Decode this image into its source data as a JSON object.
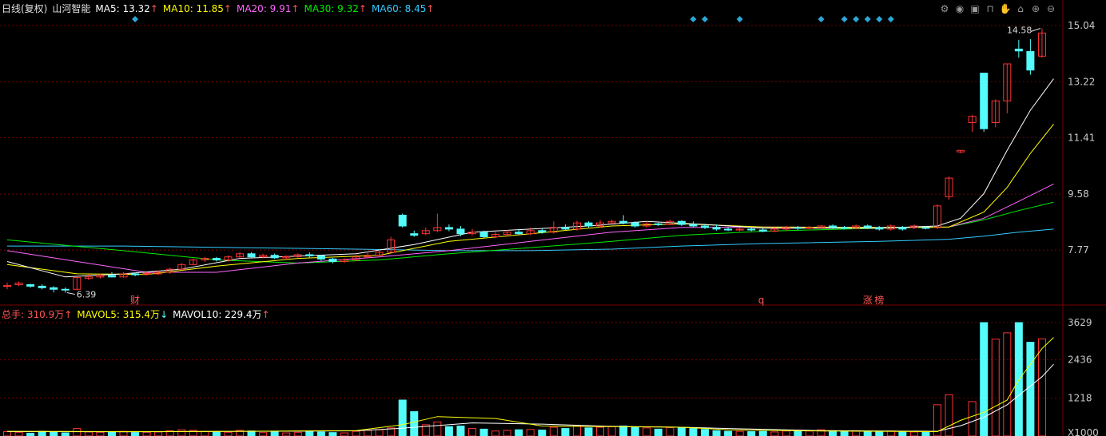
{
  "header": {
    "period": "日线(复权)",
    "name": "山河智能",
    "ma": [
      {
        "label": "MA5: 13.32",
        "arrow": "↑",
        "color": "#ffffff"
      },
      {
        "label": "MA10: 11.85",
        "arrow": "↑",
        "color": "#ffff00"
      },
      {
        "label": "MA20: 9.91",
        "arrow": "↑",
        "color": "#ff66ff"
      },
      {
        "label": "MA30: 9.32",
        "arrow": "↑",
        "color": "#00ee00"
      },
      {
        "label": "MA60: 8.45",
        "arrow": "↑",
        "color": "#33ccff"
      }
    ]
  },
  "vol_header": {
    "total": "总手: 310.9万",
    "total_arrow": "↑",
    "mavol5": "MAVOL5: 315.4万",
    "mavol5_arrow": "↓",
    "mavol10": "MAVOL10: 229.4万",
    "mavol10_arrow": "↑"
  },
  "toolbar": [
    "gear-icon",
    "eye-icon",
    "box-icon",
    "bag-icon",
    "hand-icon",
    "lock-icon",
    "plus-icon",
    "minus-icon"
  ],
  "colors": {
    "up": "#ff3333",
    "down": "#54fcfc",
    "grid": "#7a0000",
    "axis_text": "#c8c8c8",
    "ma5": "#ffffff",
    "ma10": "#ffff00",
    "ma20": "#ff66ff",
    "ma30": "#00ee00",
    "ma60": "#33ccff",
    "marker": "#2aa8d8"
  },
  "chart_data": {
    "type": "candlestick",
    "price_ticks": [
      "15.04",
      "13.22",
      "11.41",
      "9.58",
      "7.77"
    ],
    "volume_ticks": [
      "3629",
      "2436",
      "1218",
      "X1000"
    ],
    "price_range": [
      6.3,
      15.3
    ],
    "volume_range": [
      0,
      3629
    ],
    "annotations": {
      "high_label": "14.58",
      "low_label": "6.39",
      "events": [
        {
          "index": 11,
          "text": "财"
        },
        {
          "index": 65,
          "text": "q"
        },
        {
          "index": 74,
          "text": "涨"
        },
        {
          "index": 75,
          "text": "榜"
        }
      ],
      "diamonds": [
        11,
        59,
        60,
        63,
        70,
        72,
        73,
        74,
        75,
        76
      ]
    },
    "candles": [
      [
        6.6,
        6.62,
        6.5,
        6.72,
        140
      ],
      [
        6.65,
        6.7,
        6.6,
        6.75,
        120
      ],
      [
        6.65,
        6.6,
        6.55,
        6.68,
        90
      ],
      [
        6.6,
        6.55,
        6.5,
        6.66,
        150
      ],
      [
        6.55,
        6.5,
        6.4,
        6.6,
        130
      ],
      [
        6.5,
        6.48,
        6.39,
        6.56,
        100
      ],
      [
        6.5,
        6.88,
        6.46,
        6.92,
        240
      ],
      [
        6.85,
        6.9,
        6.8,
        6.98,
        130
      ],
      [
        6.9,
        6.95,
        6.85,
        7.0,
        120
      ],
      [
        6.95,
        6.9,
        6.88,
        7.05,
        140
      ],
      [
        6.9,
        7.0,
        6.88,
        7.05,
        150
      ],
      [
        7.0,
        6.97,
        6.92,
        7.04,
        110
      ],
      [
        7.0,
        7.02,
        6.95,
        7.06,
        120
      ],
      [
        7.0,
        7.05,
        6.96,
        7.1,
        130
      ],
      [
        7.05,
        7.15,
        7.0,
        7.2,
        170
      ],
      [
        7.15,
        7.3,
        7.12,
        7.35,
        200
      ],
      [
        7.3,
        7.45,
        7.28,
        7.5,
        180
      ],
      [
        7.45,
        7.5,
        7.38,
        7.55,
        150
      ],
      [
        7.5,
        7.45,
        7.4,
        7.55,
        140
      ],
      [
        7.45,
        7.55,
        7.4,
        7.6,
        120
      ],
      [
        7.55,
        7.65,
        7.5,
        7.7,
        180
      ],
      [
        7.65,
        7.55,
        7.5,
        7.7,
        160
      ],
      [
        7.55,
        7.6,
        7.5,
        7.65,
        110
      ],
      [
        7.6,
        7.52,
        7.48,
        7.66,
        130
      ],
      [
        7.52,
        7.56,
        7.46,
        7.6,
        100
      ],
      [
        7.56,
        7.62,
        7.5,
        7.66,
        120
      ],
      [
        7.62,
        7.58,
        7.52,
        7.7,
        140
      ],
      [
        7.58,
        7.48,
        7.42,
        7.62,
        130
      ],
      [
        7.48,
        7.4,
        7.34,
        7.52,
        110
      ],
      [
        7.4,
        7.45,
        7.35,
        7.5,
        100
      ],
      [
        7.45,
        7.55,
        7.42,
        7.62,
        150
      ],
      [
        7.55,
        7.6,
        7.5,
        7.72,
        180
      ],
      [
        7.6,
        7.7,
        7.55,
        7.78,
        200
      ],
      [
        7.7,
        8.1,
        7.68,
        8.2,
        260
      ],
      [
        8.9,
        8.55,
        8.5,
        8.95,
        1150
      ],
      [
        8.3,
        8.25,
        8.2,
        8.4,
        780
      ],
      [
        8.3,
        8.4,
        8.25,
        8.5,
        360
      ],
      [
        8.4,
        8.5,
        8.35,
        8.95,
        450
      ],
      [
        8.5,
        8.45,
        8.38,
        8.6,
        300
      ],
      [
        8.45,
        8.3,
        8.22,
        8.55,
        320
      ],
      [
        8.3,
        8.35,
        8.25,
        8.45,
        240
      ],
      [
        8.35,
        8.2,
        8.15,
        8.4,
        220
      ],
      [
        8.2,
        8.28,
        8.15,
        8.36,
        160
      ],
      [
        8.28,
        8.35,
        8.2,
        8.42,
        180
      ],
      [
        8.35,
        8.3,
        8.25,
        8.45,
        200
      ],
      [
        8.3,
        8.4,
        8.25,
        8.5,
        210
      ],
      [
        8.4,
        8.35,
        8.3,
        8.48,
        190
      ],
      [
        8.35,
        8.5,
        8.3,
        8.7,
        280
      ],
      [
        8.5,
        8.45,
        8.4,
        8.6,
        240
      ],
      [
        8.45,
        8.65,
        8.4,
        8.72,
        320
      ],
      [
        8.65,
        8.55,
        8.5,
        8.7,
        260
      ],
      [
        8.55,
        8.65,
        8.5,
        8.74,
        280
      ],
      [
        8.65,
        8.7,
        8.6,
        8.75,
        300
      ],
      [
        8.7,
        8.65,
        8.6,
        8.9,
        320
      ],
      [
        8.65,
        8.55,
        8.5,
        8.7,
        280
      ],
      [
        8.55,
        8.62,
        8.5,
        8.7,
        260
      ],
      [
        8.62,
        8.6,
        8.55,
        8.66,
        220
      ],
      [
        8.6,
        8.7,
        8.58,
        8.75,
        270
      ],
      [
        8.7,
        8.6,
        8.55,
        8.74,
        260
      ],
      [
        8.6,
        8.55,
        8.5,
        8.7,
        240
      ],
      [
        8.55,
        8.5,
        8.45,
        8.62,
        210
      ],
      [
        8.5,
        8.45,
        8.4,
        8.6,
        170
      ],
      [
        8.45,
        8.42,
        8.38,
        8.5,
        150
      ],
      [
        8.42,
        8.45,
        8.38,
        8.5,
        150
      ],
      [
        8.45,
        8.42,
        8.38,
        8.52,
        140
      ],
      [
        8.42,
        8.38,
        8.35,
        8.5,
        150
      ],
      [
        8.38,
        8.45,
        8.35,
        8.5,
        130
      ],
      [
        8.45,
        8.5,
        8.4,
        8.55,
        160
      ],
      [
        8.5,
        8.48,
        8.42,
        8.55,
        150
      ],
      [
        8.48,
        8.5,
        8.45,
        8.55,
        160
      ],
      [
        8.5,
        8.55,
        8.45,
        8.58,
        200
      ],
      [
        8.55,
        8.5,
        8.45,
        8.6,
        170
      ],
      [
        8.5,
        8.48,
        8.44,
        8.55,
        160
      ],
      [
        8.48,
        8.55,
        8.45,
        8.6,
        170
      ],
      [
        8.55,
        8.5,
        8.45,
        8.6,
        140
      ],
      [
        8.5,
        8.45,
        8.4,
        8.55,
        150
      ],
      [
        8.45,
        8.55,
        8.4,
        8.6,
        160
      ],
      [
        8.5,
        8.45,
        8.4,
        8.55,
        150
      ],
      [
        8.5,
        8.55,
        8.45,
        8.6,
        130
      ],
      [
        8.5,
        8.48,
        8.44,
        8.55,
        120
      ],
      [
        8.5,
        9.2,
        8.45,
        9.25,
        1000
      ],
      [
        9.5,
        10.1,
        9.4,
        10.15,
        1320
      ],
      [
        10.95,
        11.0,
        10.9,
        11.0,
        0
      ],
      [
        11.9,
        12.1,
        11.6,
        12.15,
        1100
      ],
      [
        13.5,
        11.7,
        11.6,
        13.5,
        3629
      ],
      [
        11.9,
        12.6,
        11.75,
        12.65,
        3100
      ],
      [
        12.6,
        13.8,
        12.2,
        13.8,
        3300
      ],
      [
        14.28,
        14.22,
        14.0,
        14.58,
        3629
      ],
      [
        14.2,
        13.6,
        13.45,
        14.6,
        3000
      ],
      [
        14.05,
        14.8,
        14.0,
        14.95,
        3109
      ]
    ],
    "ma_lines": {
      "ma5": [
        [
          0,
          7.4
        ],
        [
          5,
          6.9
        ],
        [
          10,
          7.0
        ],
        [
          15,
          7.15
        ],
        [
          20,
          7.5
        ],
        [
          30,
          7.65
        ],
        [
          35,
          7.95
        ],
        [
          40,
          8.35
        ],
        [
          50,
          8.55
        ],
        [
          55,
          8.7
        ],
        [
          60,
          8.6
        ],
        [
          65,
          8.48
        ],
        [
          75,
          8.48
        ],
        [
          80,
          8.55
        ],
        [
          82,
          8.8
        ],
        [
          84,
          9.6
        ],
        [
          86,
          11.0
        ],
        [
          88,
          12.3
        ],
        [
          90,
          13.32
        ]
      ],
      "ma10": [
        [
          0,
          7.3
        ],
        [
          6,
          7.0
        ],
        [
          12,
          6.98
        ],
        [
          18,
          7.25
        ],
        [
          25,
          7.5
        ],
        [
          32,
          7.6
        ],
        [
          38,
          8.05
        ],
        [
          45,
          8.3
        ],
        [
          52,
          8.55
        ],
        [
          58,
          8.62
        ],
        [
          65,
          8.52
        ],
        [
          76,
          8.5
        ],
        [
          81,
          8.52
        ],
        [
          84,
          9.0
        ],
        [
          86,
          9.8
        ],
        [
          88,
          10.9
        ],
        [
          90,
          11.85
        ]
      ],
      "ma20": [
        [
          0,
          7.75
        ],
        [
          6,
          7.4
        ],
        [
          12,
          7.05
        ],
        [
          18,
          7.05
        ],
        [
          25,
          7.35
        ],
        [
          32,
          7.55
        ],
        [
          38,
          7.75
        ],
        [
          45,
          8.05
        ],
        [
          52,
          8.35
        ],
        [
          58,
          8.5
        ],
        [
          65,
          8.52
        ],
        [
          75,
          8.5
        ],
        [
          81,
          8.52
        ],
        [
          84,
          8.8
        ],
        [
          87,
          9.35
        ],
        [
          90,
          9.91
        ]
      ],
      "ma30": [
        [
          0,
          8.1
        ],
        [
          10,
          7.75
        ],
        [
          18,
          7.45
        ],
        [
          25,
          7.35
        ],
        [
          32,
          7.45
        ],
        [
          38,
          7.65
        ],
        [
          45,
          7.85
        ],
        [
          52,
          8.05
        ],
        [
          58,
          8.25
        ],
        [
          65,
          8.38
        ],
        [
          75,
          8.48
        ],
        [
          81,
          8.52
        ],
        [
          84,
          8.75
        ],
        [
          87,
          9.05
        ],
        [
          90,
          9.32
        ]
      ],
      "ma60": [
        [
          0,
          7.9
        ],
        [
          10,
          7.9
        ],
        [
          20,
          7.85
        ],
        [
          30,
          7.8
        ],
        [
          38,
          7.75
        ],
        [
          45,
          7.75
        ],
        [
          52,
          7.8
        ],
        [
          58,
          7.9
        ],
        [
          65,
          7.98
        ],
        [
          75,
          8.05
        ],
        [
          81,
          8.12
        ],
        [
          84,
          8.22
        ],
        [
          87,
          8.35
        ],
        [
          90,
          8.45
        ]
      ]
    },
    "mavol_lines": {
      "mavol5": [
        [
          0,
          150
        ],
        [
          10,
          140
        ],
        [
          20,
          150
        ],
        [
          30,
          170
        ],
        [
          34,
          360
        ],
        [
          37,
          620
        ],
        [
          42,
          560
        ],
        [
          46,
          320
        ],
        [
          52,
          300
        ],
        [
          58,
          280
        ],
        [
          62,
          200
        ],
        [
          70,
          160
        ],
        [
          80,
          140
        ],
        [
          82,
          500
        ],
        [
          84,
          760
        ],
        [
          86,
          1150
        ],
        [
          87,
          1800
        ],
        [
          89,
          2800
        ],
        [
          90,
          3154
        ]
      ],
      "mavol10": [
        [
          0,
          140
        ],
        [
          10,
          135
        ],
        [
          20,
          145
        ],
        [
          30,
          165
        ],
        [
          34,
          250
        ],
        [
          40,
          420
        ],
        [
          46,
          380
        ],
        [
          52,
          310
        ],
        [
          58,
          280
        ],
        [
          62,
          240
        ],
        [
          70,
          170
        ],
        [
          80,
          150
        ],
        [
          82,
          330
        ],
        [
          84,
          600
        ],
        [
          86,
          1000
        ],
        [
          87,
          1300
        ],
        [
          89,
          1900
        ],
        [
          90,
          2294
        ]
      ]
    }
  }
}
